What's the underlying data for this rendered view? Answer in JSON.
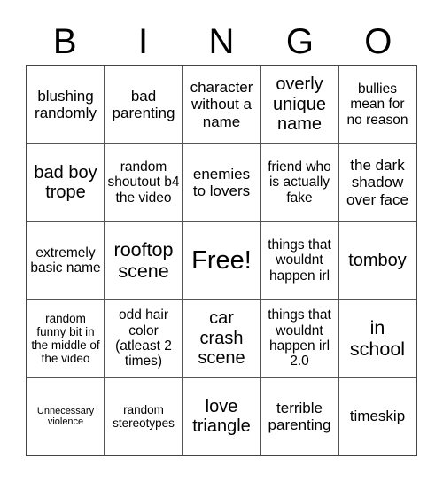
{
  "header": {
    "letters": [
      "B",
      "I",
      "N",
      "G",
      "O"
    ]
  },
  "cells": [
    "blushing randomly",
    "bad parenting",
    "character without a name",
    "overly unique name",
    "bullies mean for no reason",
    "bad boy trope",
    "random shoutout b4 the video",
    "enemies to lovers",
    "friend who is actually fake",
    "the dark shadow over face",
    "extremely basic name",
    "rooftop scene",
    "Free!",
    "things that wouldnt happen irl",
    "tomboy",
    "random funny bit in the middle of the video",
    "odd hair color (atleast 2 times)",
    "car crash scene",
    "things that wouldnt happen irl 2.0",
    "in school",
    "Unnecessary violence",
    "random stereotypes",
    "love triangle",
    "terrible parenting",
    "timeskip"
  ]
}
